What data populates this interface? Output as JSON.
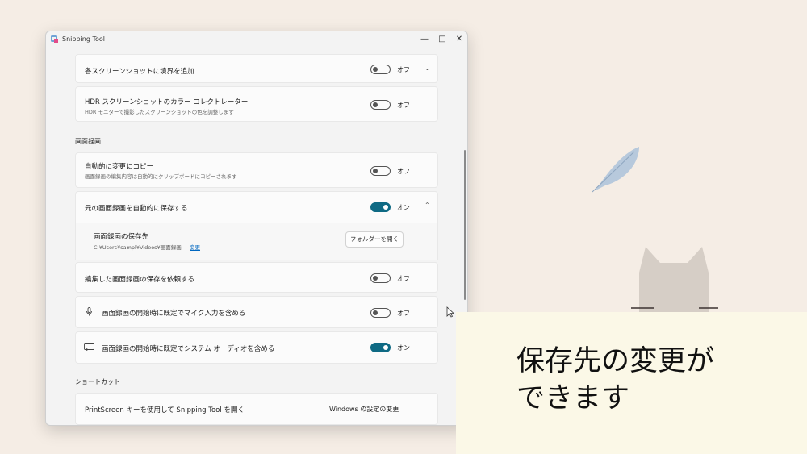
{
  "window": {
    "title": "Snipping Tool",
    "minimize_glyph": "—",
    "maximize_glyph": "□",
    "close_glyph": "✕"
  },
  "settings": {
    "border": {
      "label": "各スクリーンショットに境界を追加",
      "state": "オフ",
      "on": false
    },
    "hdr": {
      "label": "HDR スクリーンショットのカラー コレクトレーター",
      "desc": "HDR モニターで撮影したスクリーンショットの色を調整します",
      "state": "オフ",
      "on": false
    },
    "section_recording": "画面録画",
    "auto_copy": {
      "label": "自動的に変更にコピー",
      "desc": "画面録画の編集内容は自動的にクリップボードにコピーされます",
      "state": "オフ",
      "on": false
    },
    "auto_save": {
      "label": "元の画面録画を自動的に保存する",
      "state": "オン",
      "on": true
    },
    "save_location": {
      "label": "画面録画の保存先",
      "path": "C:¥Users¥sampl¥Videos¥画面録画",
      "change_link": "変更",
      "button": "フォルダーを開く"
    },
    "ask_save": {
      "label": "編集した画面録画の保存を依頼する",
      "state": "オフ",
      "on": false
    },
    "mic": {
      "label": "画面録画の開始時に既定でマイク入力を含める",
      "state": "オフ",
      "on": false
    },
    "audio": {
      "label": "画面録画の開始時に既定でシステム オーディオを含める",
      "state": "オン",
      "on": true
    },
    "section_shortcut": "ショートカット",
    "printscreen": {
      "label": "PrintScreen キーを使用して Snipping Tool を開く",
      "link": "Windows の設定の変更"
    }
  },
  "caption": {
    "line1": "保存先の変更が",
    "line2": "できます"
  },
  "colors": {
    "toggle_on": "#0f6a84",
    "arrow": "#a9d8cf",
    "caption_bg": "#fbf8e7",
    "background": "#f5ede5"
  }
}
